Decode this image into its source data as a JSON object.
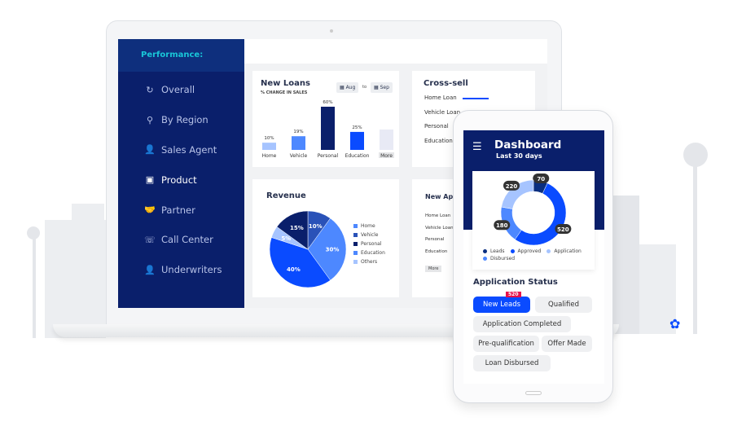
{
  "sidebar": {
    "header": "Performance:",
    "items": [
      {
        "label": "Overall",
        "icon": "refresh-icon",
        "glyph": "↻"
      },
      {
        "label": "By Region",
        "icon": "map-pin-icon",
        "glyph": "⚲"
      },
      {
        "label": "Sales Agent",
        "icon": "user-icon",
        "glyph": "👤"
      },
      {
        "label": "Product",
        "icon": "box-icon",
        "glyph": "▣",
        "active": true
      },
      {
        "label": "Partner",
        "icon": "handshake-icon",
        "glyph": "🤝"
      },
      {
        "label": "Call Center",
        "icon": "headset-icon",
        "glyph": "☏"
      },
      {
        "label": "Underwriters",
        "icon": "user-badge-icon",
        "glyph": "👤"
      }
    ]
  },
  "new_loans": {
    "title": "New Loans",
    "subtitle": "% CHANGE IN SALES",
    "from": "Aug",
    "to_label": "to",
    "to": "Sep",
    "more": "More"
  },
  "cross_sell": {
    "title": "Cross-sell",
    "items": [
      "Home Loan",
      "Vehicle Loan",
      "Personal",
      "Education"
    ],
    "home_loan_bar": 0.6
  },
  "revenue": {
    "title": "Revenue",
    "legend": [
      "Home",
      "Vehicle",
      "Personal",
      "Education",
      "Others"
    ]
  },
  "new_apps": {
    "title": "New Applications",
    "items": [
      "Home Loan",
      "Vehicle Loan",
      "Personal",
      "Education"
    ],
    "more": "More"
  },
  "phone": {
    "title": "Dashboard",
    "subtitle": "Last 30 days",
    "legend": [
      "Leads",
      "Approved",
      "Application",
      "Disbursed"
    ],
    "status_title": "Application Status",
    "badge": "520",
    "chips": [
      "New Leads",
      "Qualified",
      "Application Completed",
      "Pre-qualification",
      "Offer Made",
      "Loan Disbursed"
    ]
  },
  "colors": {
    "navy": "#0a1f6b",
    "accent": "#0a4bff",
    "teal": "#19c6d8",
    "badge": "#e8114b"
  },
  "chart_data": [
    {
      "type": "bar",
      "title": "New Loans",
      "categories": [
        "Home",
        "Vehicle",
        "Personal",
        "Education",
        "More"
      ],
      "values": [
        10,
        19,
        60,
        25,
        null
      ],
      "labels": [
        "10%",
        "19%",
        "60%",
        "25%",
        ""
      ],
      "colors": [
        "#a6c4ff",
        "#4d88ff",
        "#0a1f6b",
        "#0a4bff",
        "#e8eaf5"
      ],
      "ylim": [
        0,
        60
      ]
    },
    {
      "type": "pie",
      "title": "Revenue",
      "categories": [
        "Vehicle",
        "Education",
        "Home",
        "Others",
        "Personal"
      ],
      "values": [
        10,
        30,
        40,
        5,
        15
      ],
      "labels": [
        "10%",
        "30%",
        "40%",
        "5%",
        "15%"
      ],
      "colors": [
        "#2a52b8",
        "#4d88ff",
        "#0a4bff",
        "#a6c4ff",
        "#0a1f6b"
      ]
    },
    {
      "type": "pie",
      "title": "Dashboard",
      "categories": [
        "Leads",
        "Approved",
        "Disbursed",
        "Application"
      ],
      "values": [
        70,
        520,
        180,
        220
      ],
      "labels": [
        "70",
        "520",
        "180",
        "220"
      ],
      "colors": [
        "#0a2f80",
        "#0a4bff",
        "#4d88ff",
        "#a6c4ff"
      ]
    }
  ]
}
